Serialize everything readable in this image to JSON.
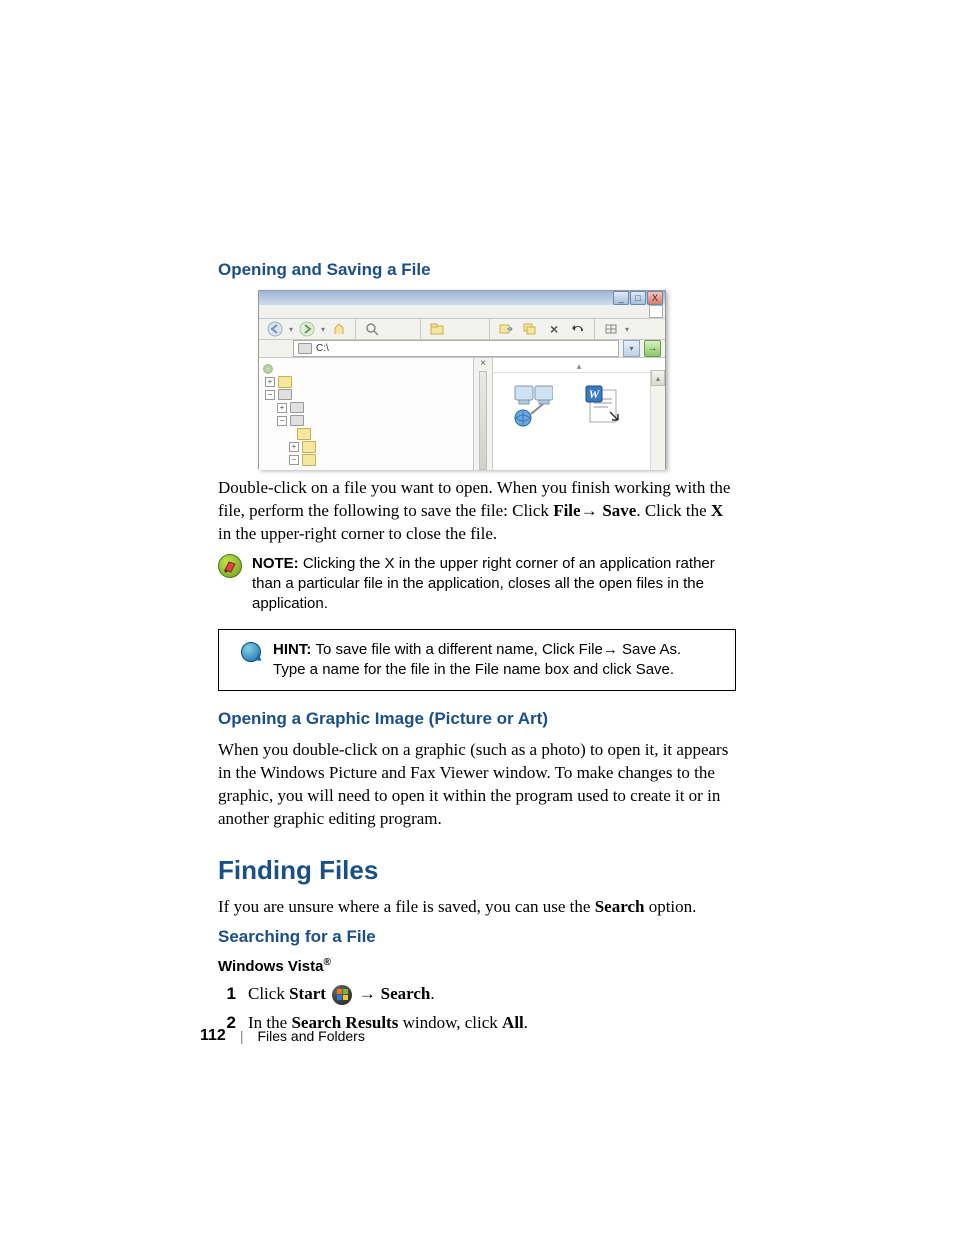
{
  "headings": {
    "h2_open_save": "Opening and Saving a File",
    "h2_open_graphic": "Opening a Graphic Image (Picture or Art)",
    "h1_finding": "Finding Files",
    "h2_searching": "Searching for a File",
    "h3_vista": "Windows Vista"
  },
  "paragraphs": {
    "open_save_1": "Double-click on a file you want to open. When you finish working with the file, perform the following to save the file: Click ",
    "open_save_file": "File",
    "open_save_arrow1": "→ ",
    "open_save_save": "Save",
    "open_save_2": ". Click the ",
    "open_save_x": "X",
    "open_save_3": " in the upper-right corner to close the file.",
    "graphic_p": "When you double-click on a graphic (such as a photo) to open it, it appears in the Windows Picture and Fax Viewer window. To make changes to the graphic, you will need to open it within the program used to create it or in another graphic editing program.",
    "finding_p1": "If you are unsure where a file is saved, you can use the ",
    "finding_search_b": "Search",
    "finding_p2": " option."
  },
  "note": {
    "label": "NOTE: ",
    "text": "Clicking the X in the upper right corner of an application rather than a particular file in the application, closes all the open files in the application."
  },
  "hint": {
    "label": "HINT: ",
    "text": "To save file with a different name, Click File→ Save As. Type a name for the file in the File name box and click Save."
  },
  "steps": {
    "s1_a": "Click ",
    "s1_start": "Start",
    "s1_b": " ",
    "s1_arrow": " → ",
    "s1_search": "Search",
    "s1_c": ".",
    "s2_a": "In the ",
    "s2_sr": "Search Results",
    "s2_b": " window, click ",
    "s2_all": "All",
    "s2_c": "."
  },
  "screenshot": {
    "address_path": "C:\\",
    "win_min": "_",
    "win_max": "□",
    "win_close": "X",
    "close_pane": "×",
    "collapse_hint": "▴"
  },
  "footer": {
    "page": "112",
    "separator": "|",
    "section": "Files and Folders"
  }
}
